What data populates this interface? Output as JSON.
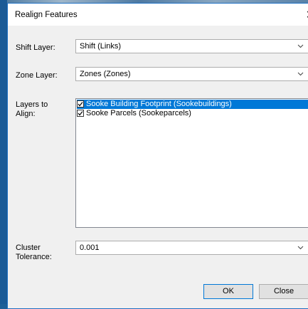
{
  "dialog": {
    "title": "Realign Features",
    "close_glyph": "✕"
  },
  "shift_layer": {
    "label": "Shift Layer:",
    "value": "Shift (Links)"
  },
  "zone_layer": {
    "label": "Zone Layer:",
    "value": "Zones (Zones)"
  },
  "layers_to_align": {
    "label_line1": "Layers to",
    "label_line2": "Align:",
    "items": [
      {
        "label": "Sooke Building Footprint (Sookebuildings)",
        "checked": true,
        "selected": true
      },
      {
        "label": "Sooke Parcels  (Sookeparcels)",
        "checked": true,
        "selected": false
      }
    ]
  },
  "cluster_tolerance": {
    "label_line1": "Cluster",
    "label_line2": "Tolerance:",
    "value": "0.001"
  },
  "buttons": {
    "ok": "OK",
    "close": "Close"
  },
  "icons": {
    "dropdown": "chevron-down-icon",
    "check": "checkmark-icon",
    "close": "close-icon"
  },
  "colors": {
    "accent": "#0078d7",
    "desktop": "#1e5f97"
  }
}
